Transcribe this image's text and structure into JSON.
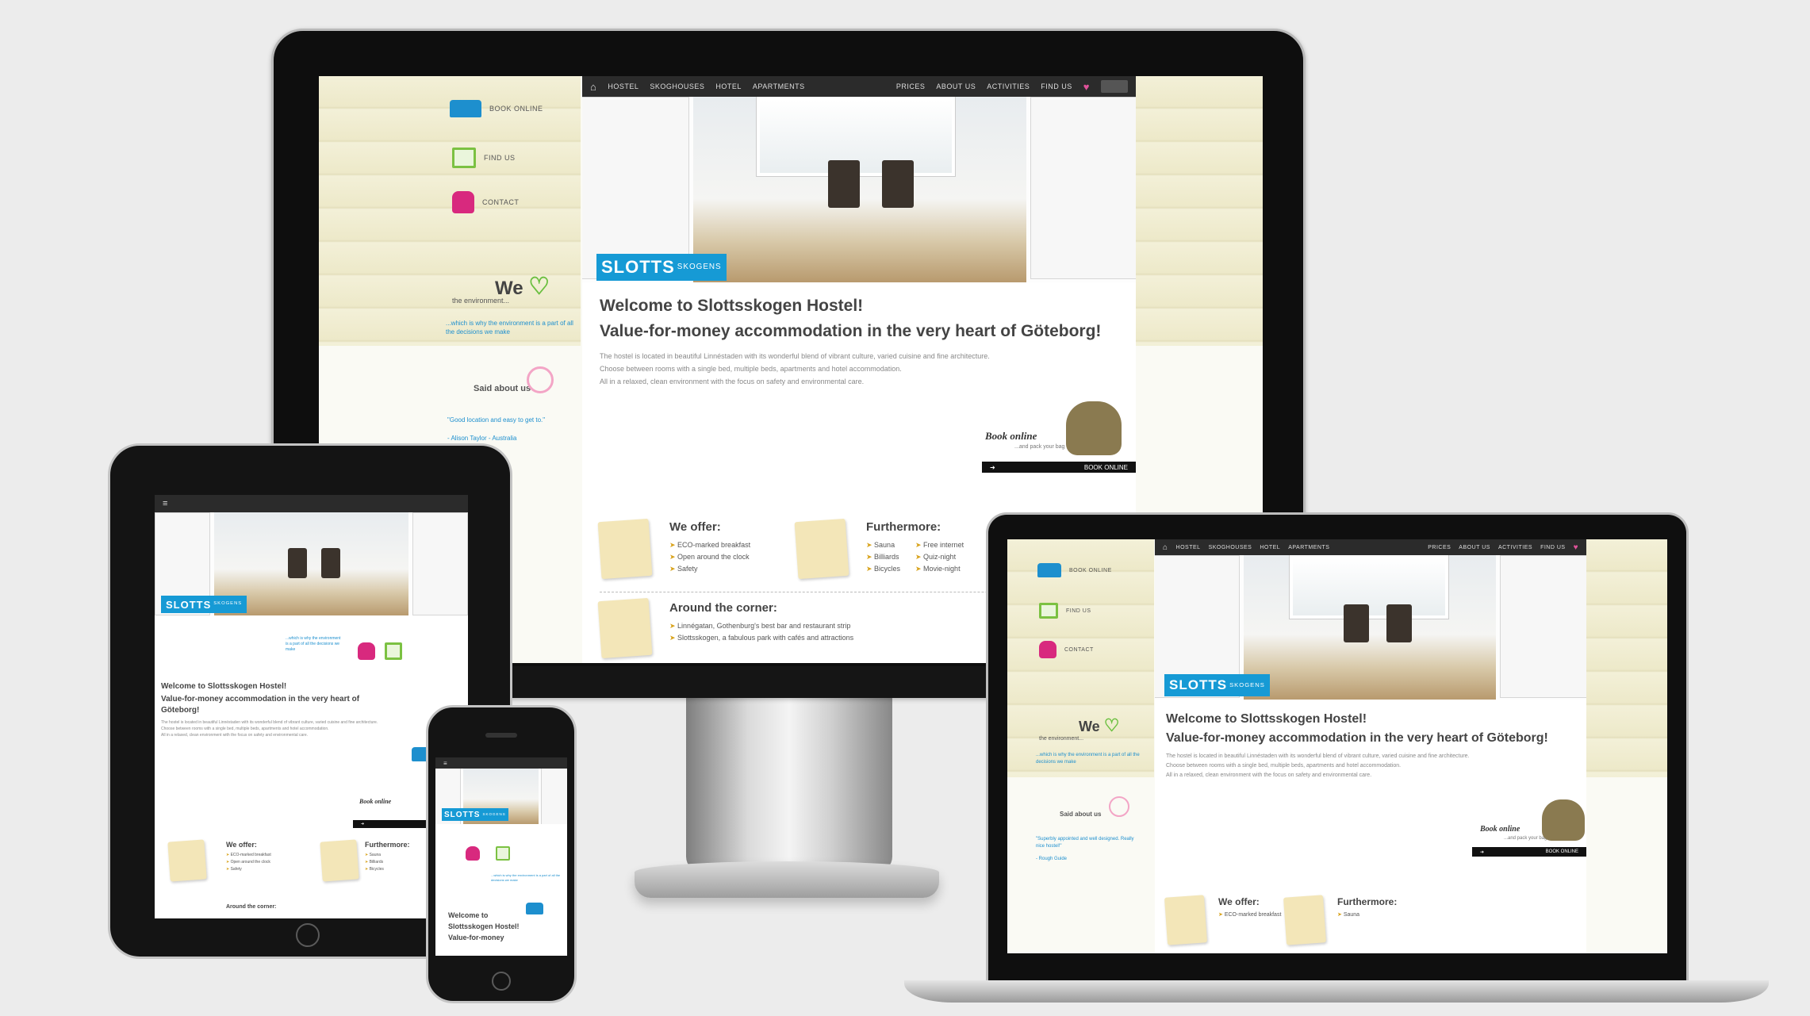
{
  "nav": {
    "left": [
      "HOSTEL",
      "SKOGHOUSES",
      "HOTEL",
      "APARTMENTS"
    ],
    "right": [
      "PRICES",
      "ABOUT US",
      "ACTIVITIES",
      "FIND US"
    ]
  },
  "sidebar": {
    "book_online": "BOOK ONLINE",
    "find_us": "FIND US",
    "contact": "CONTACT",
    "we_love": "We",
    "environment": "the environment...",
    "env_note": "...which is why the environment is a part of all the decisions we make",
    "said_about": "Said about us",
    "quote": "\"Good location and easy to get to.\"",
    "quote_author": "- Alison Taylor - Australia"
  },
  "logo": {
    "main": "SLOTTS",
    "sub": "SKOGENS"
  },
  "welcome": {
    "title": "Welcome to Slottsskogen Hostel!",
    "subtitle": "Value-for-money accommodation in the very heart of Göteborg!",
    "p1": "The hostel is located in beautiful Linnéstaden with its wonderful blend of vibrant culture, varied cuisine and fine architecture.",
    "p2": "Choose between rooms with a single bed, multiple beds, apartments and hotel accommodation.",
    "p3": "All in a relaxed, clean environment with the focus on safety and environmental care."
  },
  "book": {
    "title": "Book online",
    "sub": "...and pack your bag",
    "bar": "BOOK ONLINE"
  },
  "offer": {
    "title": "We offer:",
    "items": [
      "ECO-marked breakfast",
      "Open around the clock",
      "Safety"
    ]
  },
  "furthermore": {
    "title": "Furthermore:",
    "items": [
      "Sauna",
      "Billiards",
      "Bicycles"
    ],
    "items2": [
      "Free internet",
      "Quiz-night",
      "Movie-night"
    ]
  },
  "corner": {
    "title": "Around the corner:",
    "items": [
      "Linnégatan, Gothenburg's best bar and restaurant strip",
      "Slottsskogen, a fabulous park with cafés and attractions"
    ]
  },
  "tablet": {
    "title_line1": "Welcome to Slottsskogen Hostel!",
    "title_line2": "Value-for-money accommodation in the very heart of",
    "title_line3": "Göteborg!",
    "around": "Around the corner:"
  },
  "phone": {
    "welcome": "Welcome to",
    "hostel": "Slottsskogen Hostel!",
    "value": "Value-for-money"
  },
  "laptop": {
    "quote": "\"Superbly appointed and well designed. Really nice hostel!\"",
    "quote_author": "- Rough Guide"
  },
  "colors": {
    "accent_blue": "#169ad5",
    "green": "#6abf3f",
    "pink": "#d8297e",
    "background": "#ececec"
  }
}
